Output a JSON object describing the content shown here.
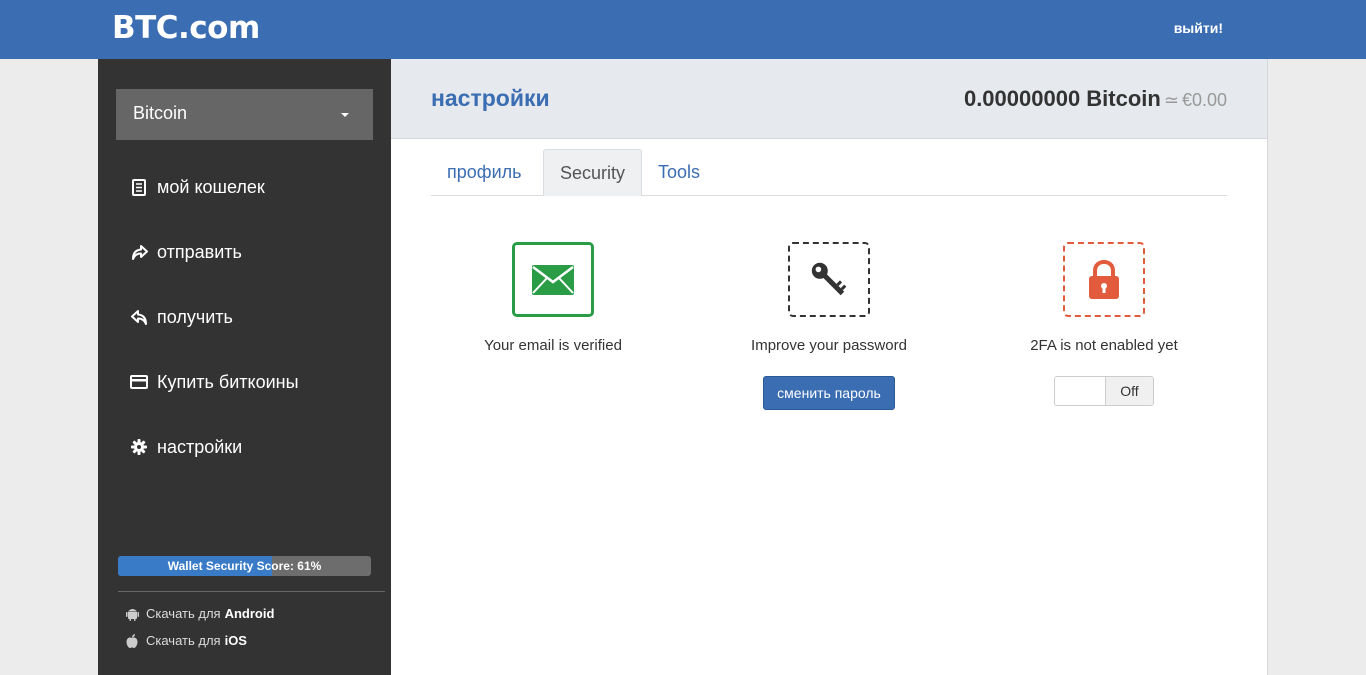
{
  "header": {
    "logo": "BTC.com",
    "logout_label": "выйти!"
  },
  "sidebar": {
    "currency_selected": "Bitcoin",
    "items": [
      {
        "label": "мой кошелек",
        "icon": "document-icon"
      },
      {
        "label": "отправить",
        "icon": "share-arrow-icon"
      },
      {
        "label": "получить",
        "icon": "reply-arrow-icon"
      },
      {
        "label": "Купить биткоины",
        "icon": "credit-card-icon"
      },
      {
        "label": "настройки",
        "icon": "gear-icon"
      }
    ],
    "security_score": {
      "label": "Wallet Security Score: 61%",
      "percent": 61
    },
    "apps": [
      {
        "prefix": "Скачать для",
        "platform": "Android",
        "icon": "android-icon"
      },
      {
        "prefix": "Скачать для",
        "platform": "iOS",
        "icon": "apple-icon"
      }
    ]
  },
  "main": {
    "title": "настройки",
    "balance": {
      "amount": "0.00000000 Bitcoin",
      "approx_symbol": "≃",
      "fiat": "€0.00"
    },
    "tabs": [
      {
        "label": "профиль",
        "active": false
      },
      {
        "label": "Security",
        "active": true
      },
      {
        "label": "Tools",
        "active": false
      }
    ],
    "security": {
      "email": {
        "label": "Your email is verified",
        "icon": "envelope-icon",
        "color": "#2a9c46"
      },
      "password": {
        "label": "Improve your password",
        "button_label": "сменить пароль",
        "icon": "key-icon"
      },
      "twofa": {
        "label": "2FA is not enabled yet",
        "toggle_state": "Off",
        "icon": "padlock-icon",
        "color": "#e25b3c"
      }
    }
  },
  "colors": {
    "brand": "#3a6db2",
    "sidebar_bg": "#333333",
    "success": "#2a9c46",
    "danger": "#e25b3c"
  }
}
